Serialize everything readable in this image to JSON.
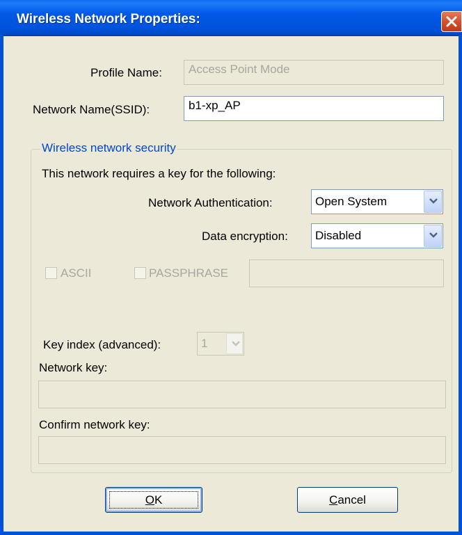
{
  "window": {
    "title": "Wireless Network Properties:"
  },
  "form": {
    "profile_name_label": "Profile Name:",
    "profile_name_value": "Access Point Mode",
    "ssid_label": "Network Name(SSID):",
    "ssid_value": "b1-xp_AP"
  },
  "security": {
    "group_title": "Wireless network security",
    "requires_key_text": "This network requires a key for the following:",
    "auth_label": "Network Authentication:",
    "auth_value": "Open System",
    "encryption_label": "Data encryption:",
    "encryption_value": "Disabled",
    "ascii_label": "ASCII",
    "ascii_checked": false,
    "passphrase_label": "PASSPHRASE",
    "passphrase_checked": false,
    "passphrase_value": "",
    "key_index_label": "Key index (advanced):",
    "key_index_value": "1",
    "network_key_label": "Network key:",
    "network_key_value": "",
    "confirm_key_label": "Confirm network key:",
    "confirm_key_value": ""
  },
  "buttons": {
    "ok_first": "O",
    "ok_rest": "K",
    "cancel_first": "C",
    "cancel_rest": "ancel"
  }
}
